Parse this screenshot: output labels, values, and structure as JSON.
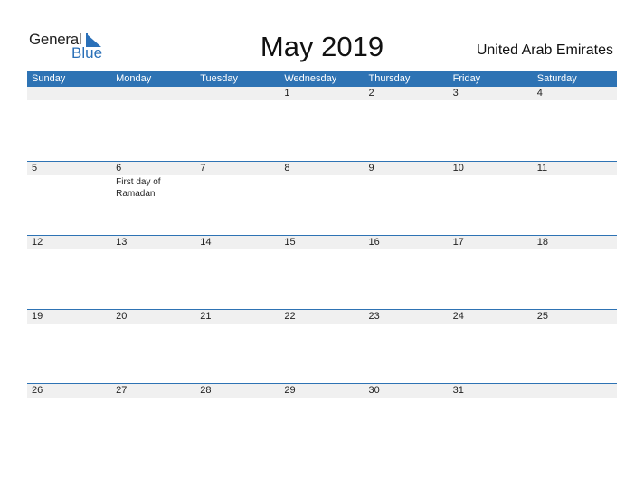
{
  "logo": {
    "general": "General",
    "blue": "Blue"
  },
  "title": "May 2019",
  "country": "United Arab Emirates",
  "colors": {
    "accent": "#2e73b4",
    "strip": "#f0f0f0"
  },
  "weekdays": [
    "Sunday",
    "Monday",
    "Tuesday",
    "Wednesday",
    "Thursday",
    "Friday",
    "Saturday"
  ],
  "weeks": [
    {
      "days": [
        "",
        "",
        "",
        "1",
        "2",
        "3",
        "4"
      ],
      "events": [
        "",
        "",
        "",
        "",
        "",
        "",
        ""
      ]
    },
    {
      "days": [
        "5",
        "6",
        "7",
        "8",
        "9",
        "10",
        "11"
      ],
      "events": [
        "",
        "First day of Ramadan",
        "",
        "",
        "",
        "",
        ""
      ]
    },
    {
      "days": [
        "12",
        "13",
        "14",
        "15",
        "16",
        "17",
        "18"
      ],
      "events": [
        "",
        "",
        "",
        "",
        "",
        "",
        ""
      ]
    },
    {
      "days": [
        "19",
        "20",
        "21",
        "22",
        "23",
        "24",
        "25"
      ],
      "events": [
        "",
        "",
        "",
        "",
        "",
        "",
        ""
      ]
    },
    {
      "days": [
        "26",
        "27",
        "28",
        "29",
        "30",
        "31",
        ""
      ],
      "events": [
        "",
        "",
        "",
        "",
        "",
        "",
        ""
      ]
    }
  ]
}
